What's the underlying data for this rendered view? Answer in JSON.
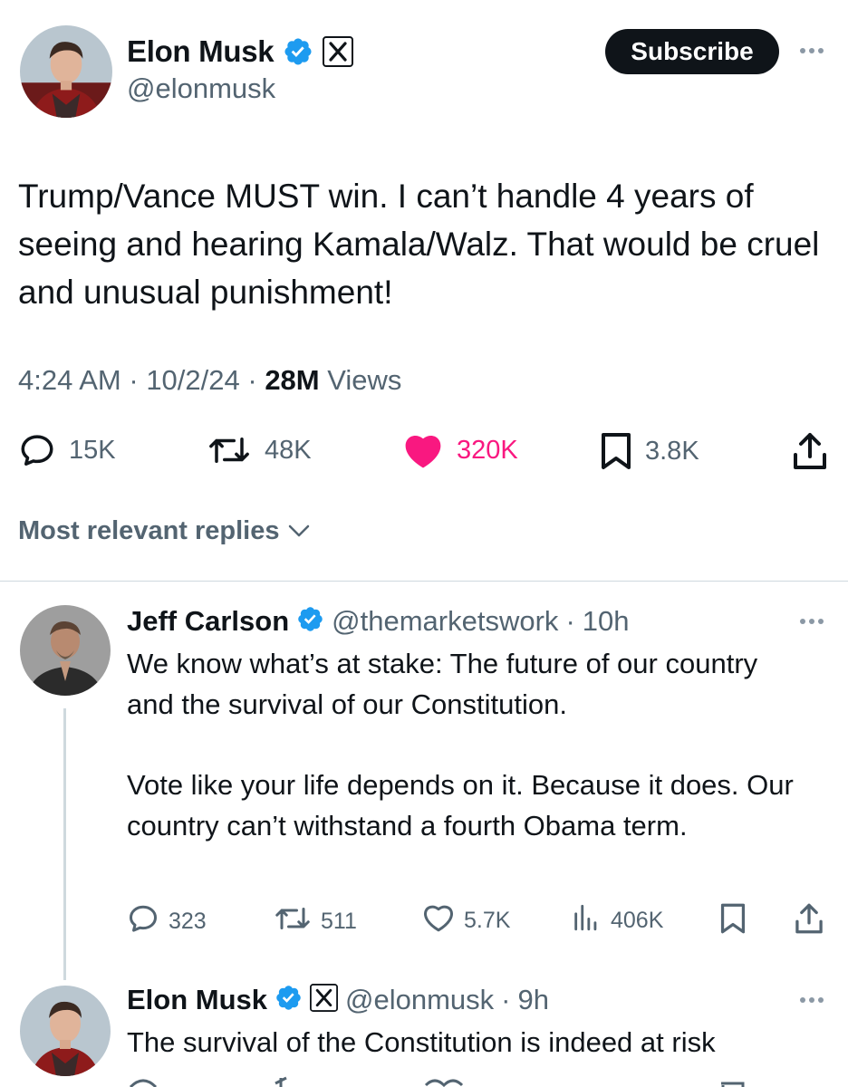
{
  "main_tweet": {
    "author_name": "Elon Musk",
    "handle": "@elonmusk",
    "subscribe_label": "Subscribe",
    "text": "Trump/Vance MUST win. I can’t handle 4 years of seeing and hearing Kamala/Walz. That would be cruel and unusual punishment!",
    "time": "4:24 AM",
    "date": "10/2/24",
    "views_count": "28M",
    "views_label": "Views",
    "replies": "15K",
    "reposts": "48K",
    "likes": "320K",
    "bookmarks": "3.8K"
  },
  "replies_filter": {
    "label": "Most relevant replies"
  },
  "reply_1": {
    "author_name": "Jeff Carlson",
    "handle": "@themarketswork",
    "age": "10h",
    "text_p1": "We know what’s at stake: The future of our country and the survival of our Constitution.",
    "text_p2": "Vote like your life depends on it. Because it does. Our country can’t withstand a fourth Obama term.",
    "replies": "323",
    "reposts": "511",
    "likes": "5.7K",
    "views": "406K"
  },
  "reply_2": {
    "author_name": "Elon Musk",
    "handle": "@elonmusk",
    "age": "9h",
    "text": "The survival of the Constitution is indeed at risk"
  },
  "colors": {
    "text": "#0f1419",
    "secondary": "#536471",
    "verified": "#1d9bf0",
    "like_active": "#f91880",
    "divider": "#cfd9de"
  }
}
